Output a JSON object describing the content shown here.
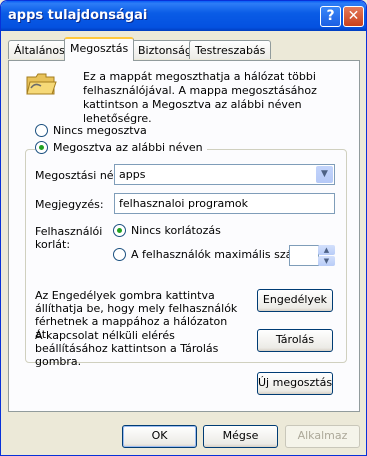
{
  "window": {
    "title": "apps tulajdonságai",
    "help_glyph": "?",
    "close_glyph": "✕"
  },
  "tabs": [
    {
      "label": "Általános"
    },
    {
      "label": "Megosztás"
    },
    {
      "label": "Biztonság"
    },
    {
      "label": "Testreszabás"
    }
  ],
  "sharing": {
    "intro": "Ez a mappát megoszthatja a hálózat többi felhasználójával. A mappa megosztásához kattintson a Megosztva az alábbi néven lehetőségre.",
    "not_shared": "Nincs megosztva",
    "shared_as": "Megosztva az alábbi néven",
    "share_name_label": "Megosztási név:",
    "share_name_value": "apps",
    "comment_label": "Megjegyzés:",
    "comment_value": "felhasznaloi programok",
    "user_limit_label": "Felhasználói korlát:",
    "no_limit": "Nincs korlátozás",
    "max_users": "A felhasználók maximális száma:",
    "max_users_value": "",
    "permissions_desc": "Az Engedélyek gombra kattintva állíthatja be, hogy mely felhasználók férhetnek a mappához a hálózaton át.",
    "permissions_button": "Engedélyek",
    "caching_desc": "A kapcsolat nélküli elérés beállításához kattintson a Tárolás gombra.",
    "caching_button": "Tárolás",
    "new_share_button": "Új megosztás"
  },
  "footer": {
    "ok": "OK",
    "cancel": "Mégse",
    "apply": "Alkalmaz"
  },
  "colors": {
    "title_bar": "#0a5ce6",
    "dialog_bg": "#ece9d8",
    "panel_bg": "#fcfcfe",
    "active_tab_accent": "#ffc83c"
  }
}
